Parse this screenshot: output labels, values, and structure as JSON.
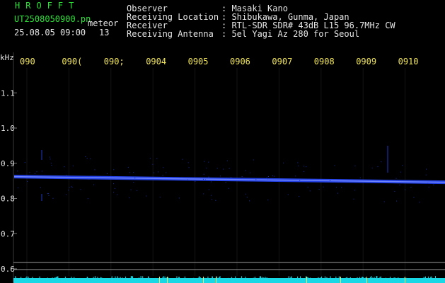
{
  "header": {
    "logo": "HROFFT",
    "filename": "UT2508050900.pn",
    "meteor_label": "meteor",
    "datetime": "25.08.05 09:00",
    "meteor_count": "13"
  },
  "meta": [
    {
      "key": "Observer",
      "sep": ": ",
      "value": "Masaki Kano"
    },
    {
      "key": "Receiving Location",
      "sep": ": ",
      "value": "Shibukawa, Gunma, Japan"
    },
    {
      "key": "Receiver",
      "sep": ": ",
      "value": "RTL-SDR SDR# 43dB L15 96.7MHz CW"
    },
    {
      "key": "Receiving Antenna",
      "sep": ": ",
      "value": "5el Yagi Az 280 for Seoul"
    }
  ],
  "axis": {
    "unit": "kHz",
    "y_ticks": [
      "1.1",
      "1.0",
      "0.9",
      "0.8",
      "0.7",
      "0.6"
    ],
    "y_values": [
      1.1,
      1.0,
      0.9,
      0.8,
      0.7,
      0.6
    ],
    "x_ticks": [
      "090",
      "090",
      "090",
      "090",
      "090",
      "090",
      "090",
      "090",
      "090",
      "0910"
    ],
    "x_tick_suffix_glyphs": [
      "",
      "(",
      ";",
      "4",
      "5",
      "6",
      "7",
      "8",
      "9",
      ""
    ]
  },
  "signal": {
    "start_khz": 0.862,
    "end_khz": 0.846,
    "color": "#2a4bff"
  },
  "colors": {
    "grid_major": "#3a3a3a",
    "axis_text": "#f2e65a",
    "label_text": "#e6e6e6",
    "logo": "#2fe03a",
    "noise_band": "#19d8e6"
  }
}
